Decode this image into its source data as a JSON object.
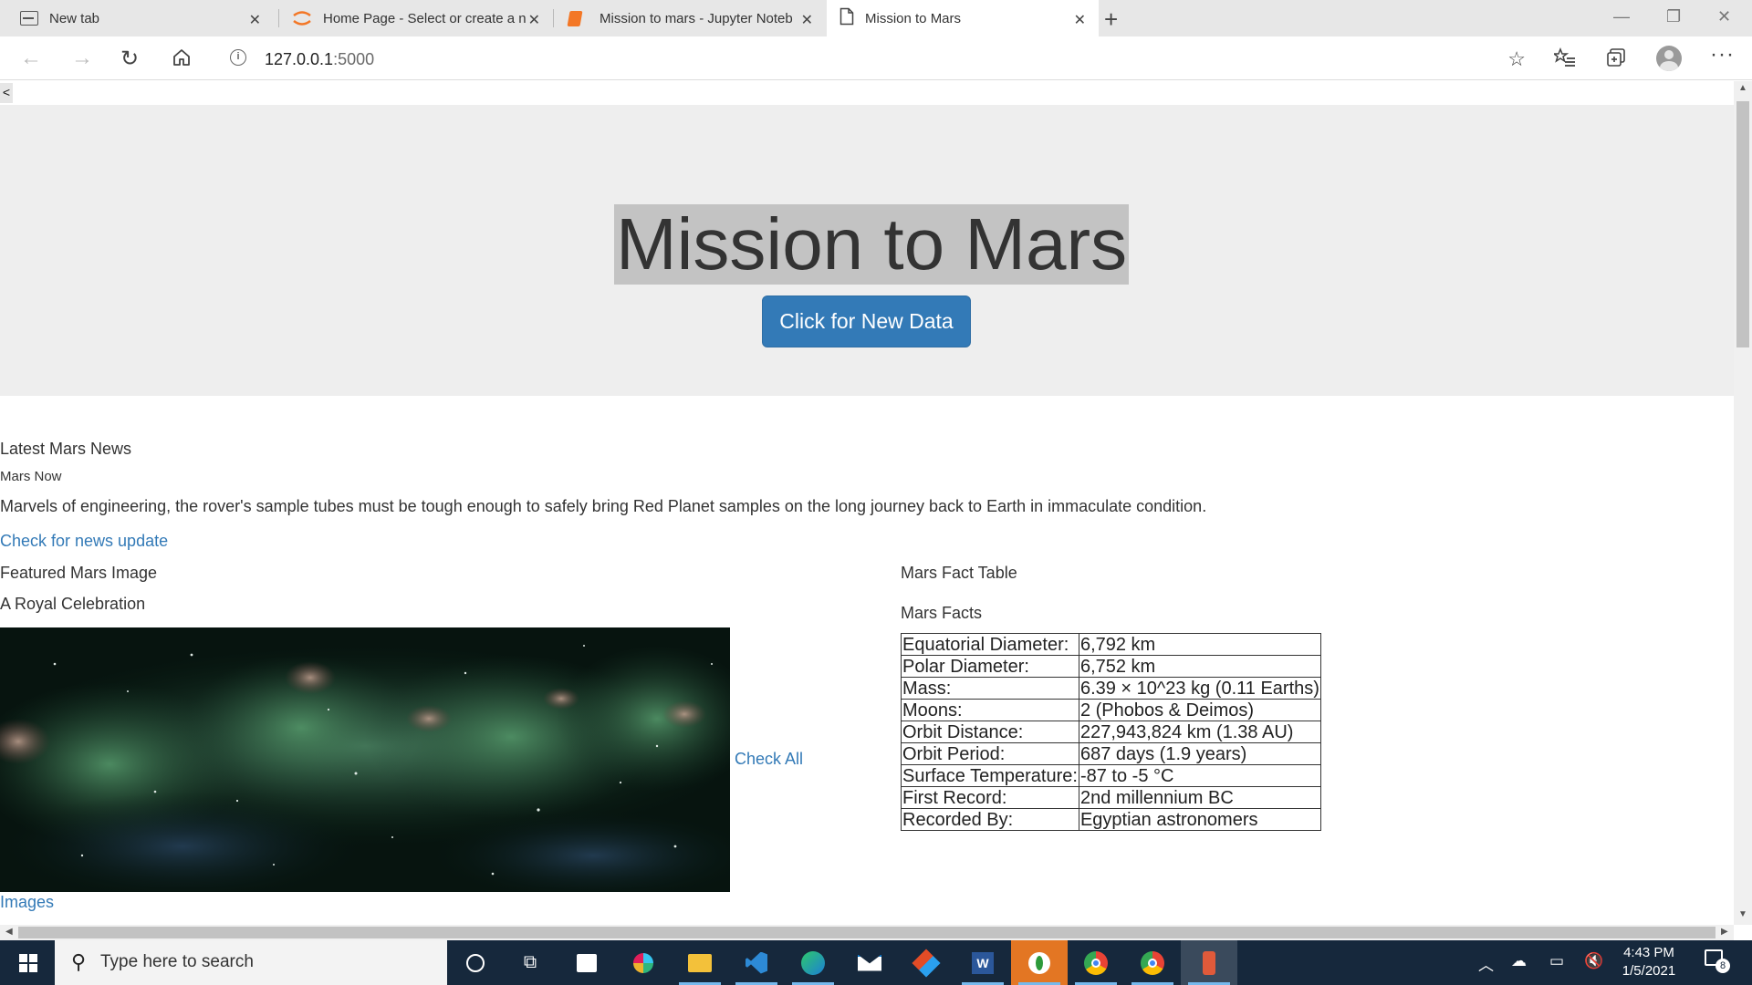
{
  "browser": {
    "tabs": [
      {
        "title": "New tab",
        "icon": "new-tab-page-icon"
      },
      {
        "title": "Home Page - Select or create a n",
        "icon": "jupyter-icon"
      },
      {
        "title": "Mission to mars - Jupyter Noteb",
        "icon": "notebook-icon"
      },
      {
        "title": "Mission to Mars",
        "icon": "page-icon"
      }
    ],
    "url_host": "127.0.0.1",
    "url_port": ":5000"
  },
  "page": {
    "toggle_label": "<",
    "title": "Mission to Mars",
    "scrape_button": "Click for New Data",
    "news_heading": "Latest Mars News",
    "news_title": "Mars Now",
    "news_paragraph": "Marvels of engineering, the rover's sample tubes must be tough enough to safely bring Red Planet samples on the long journey back to Earth in immaculate condition.",
    "news_link": "Check for news update",
    "featured_heading": "Featured Mars Image",
    "featured_title": "A Royal Celebration",
    "check_all_link": "Check All",
    "images_link": "Images",
    "facts_heading": "Mars Fact Table",
    "facts_subheading": "Mars Facts",
    "facts": [
      {
        "label": "Equatorial Diameter:",
        "value": "6,792 km"
      },
      {
        "label": "Polar Diameter:",
        "value": "6,752 km"
      },
      {
        "label": "Mass:",
        "value": "6.39 × 10^23 kg (0.11 Earths)"
      },
      {
        "label": "Moons:",
        "value": "2 (Phobos & Deimos)"
      },
      {
        "label": "Orbit Distance:",
        "value": "227,943,824 km (1.38 AU)"
      },
      {
        "label": "Orbit Period:",
        "value": "687 days (1.9 years)"
      },
      {
        "label": "Surface Temperature:",
        "value": "-87 to -5 °C"
      },
      {
        "label": "First Record:",
        "value": "2nd millennium BC"
      },
      {
        "label": "Recorded By:",
        "value": "Egyptian astronomers"
      }
    ]
  },
  "taskbar": {
    "search_placeholder": "Type here to search",
    "time": "4:43 PM",
    "date": "1/5/2021",
    "notification_count": "8"
  }
}
